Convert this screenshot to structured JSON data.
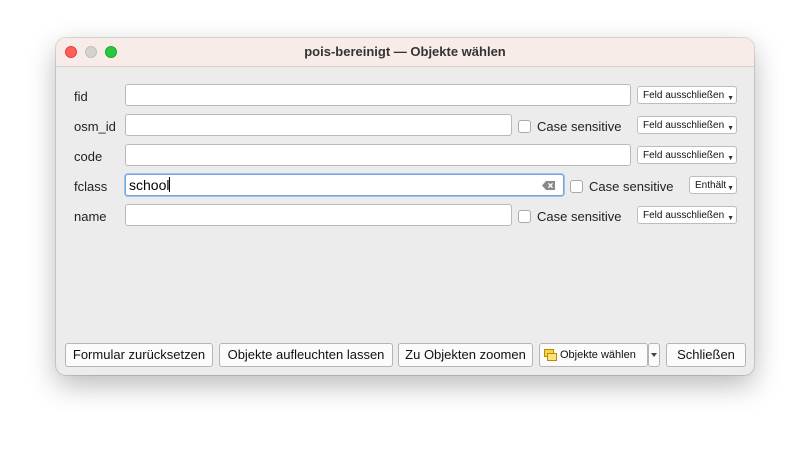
{
  "window": {
    "title": "pois-bereinigt — Objekte wählen"
  },
  "fields": [
    {
      "label": "fid",
      "value": "",
      "mode": "Feld ausschließen"
    },
    {
      "label": "osm_id",
      "value": "",
      "case_label": "Case sensitive",
      "mode": "Feld ausschließen"
    },
    {
      "label": "code",
      "value": "",
      "mode": "Feld ausschließen"
    },
    {
      "label": "fclass",
      "value": "school",
      "case_label": "Case sensitive",
      "mode": "Enthält"
    },
    {
      "label": "name",
      "value": "",
      "case_label": "Case sensitive",
      "mode": "Feld ausschließen"
    }
  ],
  "buttons": {
    "reset": "Formular zurücksetzen",
    "flash": "Objekte aufleuchten lassen",
    "zoom": "Zu Objekten zoomen",
    "select": "Objekte wählen",
    "close": "Schließen"
  },
  "icons": {
    "clear": "clear-text-icon",
    "dropdown": "chevron-down-icon",
    "select": "select-features-icon"
  }
}
